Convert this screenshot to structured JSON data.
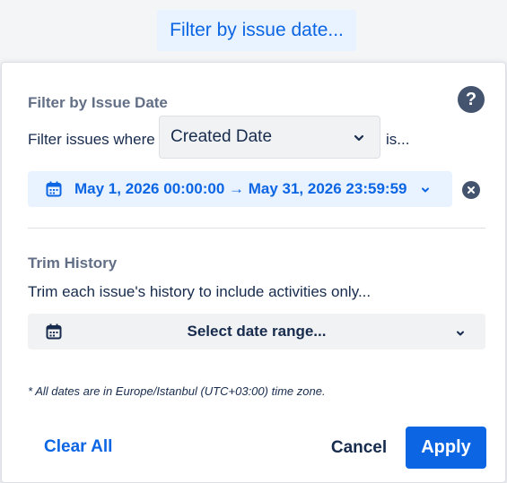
{
  "trigger": {
    "label": "Filter by issue date..."
  },
  "issue_date": {
    "title": "Filter by Issue Date",
    "help": "?",
    "prefix": "Filter issues where",
    "field_selected": "Created Date",
    "suffix": "is...",
    "range_value": "May 1, 2026 00:00:00 → May 31, 2026 23:59:59"
  },
  "trim_history": {
    "title": "Trim History",
    "description": "Trim each issue's history to include activities only...",
    "range_placeholder": "Select date range..."
  },
  "timezone_note": "* All dates are in Europe/Istanbul (UTC+03:00) time zone.",
  "actions": {
    "clear_all": "Clear All",
    "cancel": "Cancel",
    "apply": "Apply"
  },
  "colors": {
    "accent": "#0c66e4",
    "accent_bg": "#e9f2ff",
    "text": "#172b4d",
    "muted": "#626f86"
  }
}
